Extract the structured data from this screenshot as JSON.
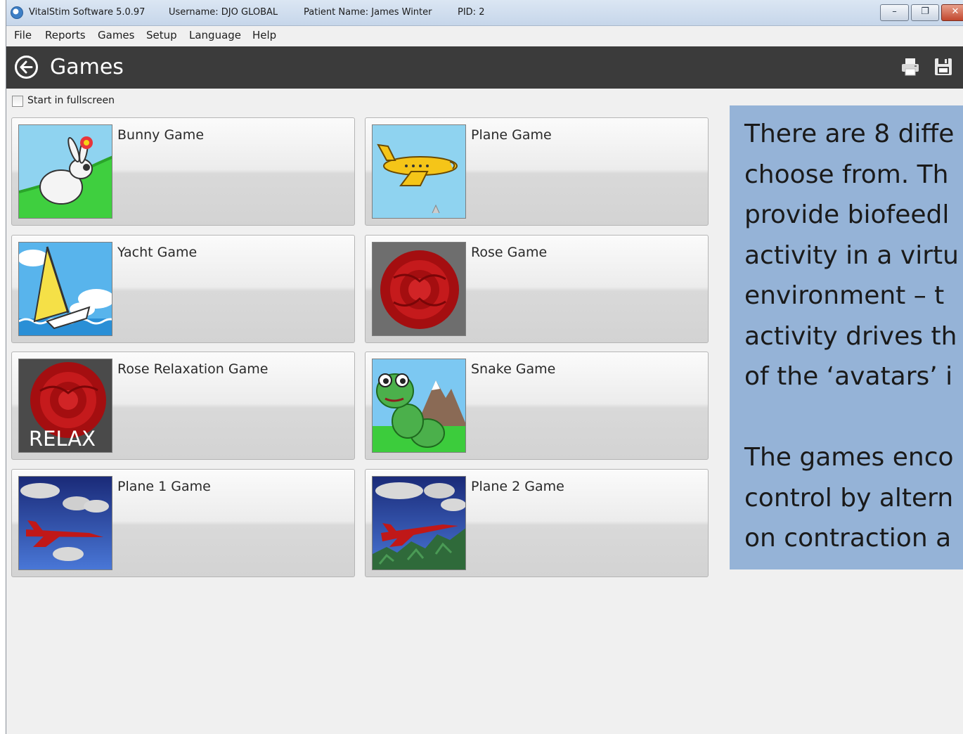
{
  "titlebar": {
    "app_name": "VitalStim Software 5.0.97",
    "username": "Username: DJO GLOBAL",
    "patient": "Patient Name: James Winter",
    "pid": "PID: 2",
    "minimize": "–",
    "restore": "❐",
    "close": "✕"
  },
  "menu": {
    "file": "File",
    "reports": "Reports",
    "games": "Games",
    "setup": "Setup",
    "language": "Language",
    "help": "Help"
  },
  "header": {
    "title": "Games",
    "icons": [
      "back-arrow-icon",
      "printer-icon",
      "floppy-disk-icon"
    ]
  },
  "options": {
    "fullscreen_label": "Start in fullscreen",
    "fullscreen_checked": false
  },
  "games": [
    {
      "label": "Bunny Game",
      "icon": "bunny-thumbnail"
    },
    {
      "label": "Plane Game",
      "icon": "plane-thumbnail"
    },
    {
      "label": "Yacht Game",
      "icon": "yacht-thumbnail"
    },
    {
      "label": "Rose Game",
      "icon": "rose-thumbnail"
    },
    {
      "label": "Rose Relaxation Game",
      "icon": "rose-relax-thumbnail",
      "badge": "RELAX"
    },
    {
      "label": "Snake Game",
      "icon": "snake-thumbnail"
    },
    {
      "label": "Plane 1 Game",
      "icon": "jet-thumbnail"
    },
    {
      "label": "Plane 2 Game",
      "icon": "jet-terrain-thumbnail"
    }
  ],
  "info": {
    "paragraph1": "There are 8 diffe\nchoose from. Th\nprovide biofeedl\nactivity in a virtu\nenvironment – t\nactivity drives th\nof the ‘avatars’ i",
    "paragraph2": "The games enco\ncontrol by altern\non contraction a",
    "background": "#95b3d7"
  }
}
